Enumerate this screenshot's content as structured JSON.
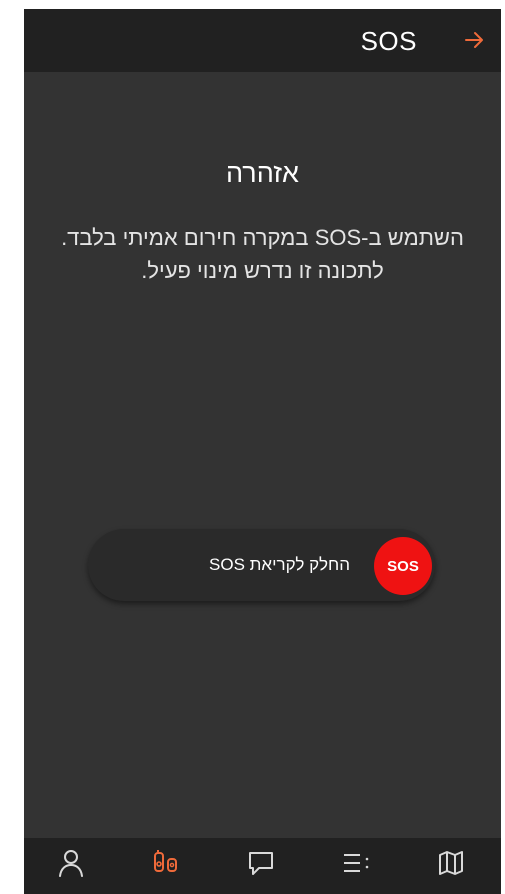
{
  "header": {
    "title": "SOS",
    "back_icon": "arrow-right-icon"
  },
  "warning": {
    "title": "אזהרה",
    "message": "השתמש ב-SOS במקרה חירום אמיתי בלבד. לתכונה זו נדרש מינוי פעיל."
  },
  "slider": {
    "label": "החלק לקריאת SOS",
    "button_label": "SOS"
  },
  "bottom_nav": {
    "items": [
      {
        "icon": "profile-icon"
      },
      {
        "icon": "devices-icon",
        "active": true
      },
      {
        "icon": "chat-icon"
      },
      {
        "icon": "menu-icon"
      },
      {
        "icon": "map-icon"
      }
    ]
  },
  "colors": {
    "background": "#333333",
    "bar": "#212121",
    "accent": "#ef6a3a",
    "sos": "#ef1212",
    "nav_icon": "#d9d9d9"
  }
}
